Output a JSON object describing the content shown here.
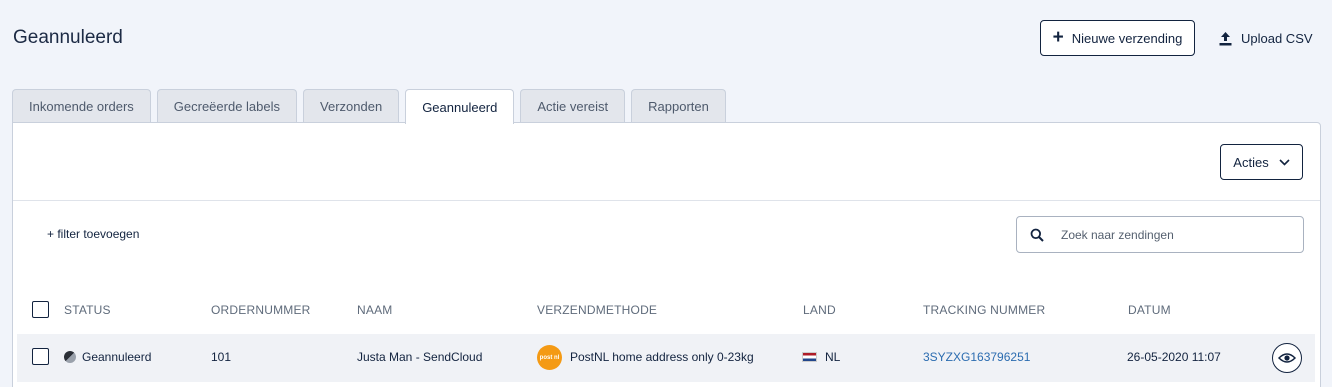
{
  "header": {
    "title": "Geannuleerd",
    "new_shipment_label": "Nieuwe verzending",
    "upload_csv_label": "Upload CSV"
  },
  "tabs": [
    {
      "label": "Inkomende orders",
      "active": false
    },
    {
      "label": "Gecreëerde labels",
      "active": false
    },
    {
      "label": "Verzonden",
      "active": false
    },
    {
      "label": "Geannuleerd",
      "active": true
    },
    {
      "label": "Actie vereist",
      "active": false
    },
    {
      "label": "Rapporten",
      "active": false
    }
  ],
  "toolbar": {
    "actions_label": "Acties",
    "add_filter_label": "+ filter toevoegen",
    "search_placeholder": "Zoek naar zendingen",
    "search_value": ""
  },
  "table": {
    "columns": [
      "STATUS",
      "ORDERNUMMER",
      "NAAM",
      "VERZENDMETHODE",
      "LAND",
      "TRACKING NUMMER",
      "DATUM"
    ],
    "rows": [
      {
        "status": "Geannuleerd",
        "order_number": "101",
        "name": "Justa Man - SendCloud",
        "shipping_method": "PostNL home address only 0-23kg",
        "carrier_logo_text": "post nl",
        "country": "NL",
        "tracking_number": "3SYZXG163796251",
        "date": "26-05-2020 11:07"
      }
    ]
  },
  "colors": {
    "background": "#f1f4fa",
    "primary_text": "#12233f",
    "link": "#2b6cb0",
    "postnl_orange": "#f49a14"
  },
  "icons": {
    "new_shipment": "plus-icon",
    "upload": "upload-icon",
    "actions": "chevron-down-icon",
    "search": "search-icon",
    "view": "eye-icon",
    "carrier": "postnl-logo",
    "country": "nl-flag-icon"
  }
}
